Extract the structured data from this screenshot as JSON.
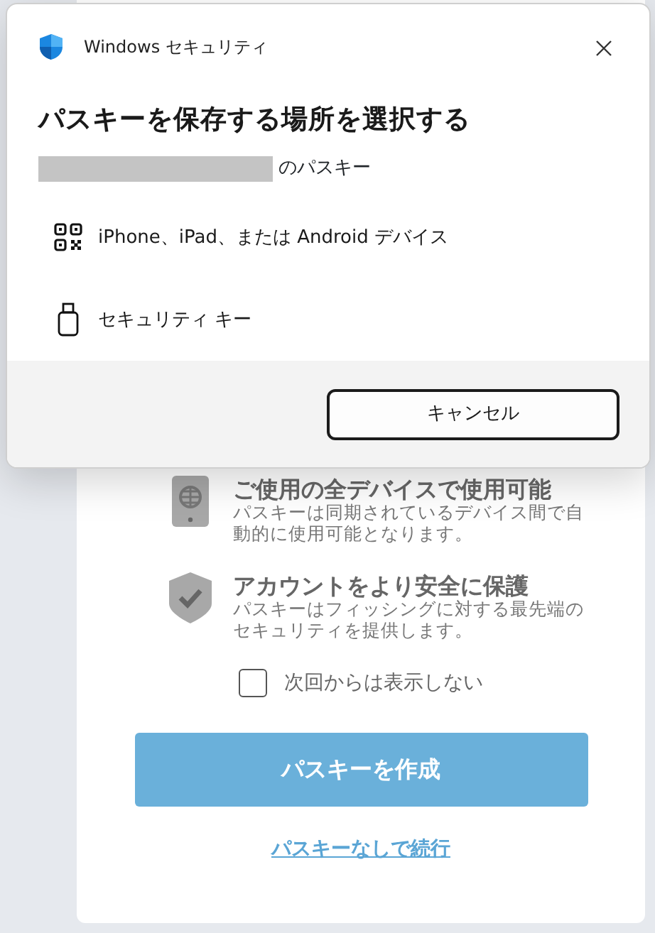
{
  "dialog": {
    "app_title": "Windows セキュリティ",
    "heading": "パスキーを保存する場所を選択する",
    "account_suffix": "のパスキー",
    "options": [
      {
        "kind": "qr",
        "label": "iPhone、iPad、または Android デバイス"
      },
      {
        "kind": "security_key",
        "label": "セキュリティ キー"
      }
    ],
    "cancel_button": "キャンセル"
  },
  "page": {
    "features": [
      {
        "kind": "device",
        "title": "ご使用の全デバイスで使用可能",
        "description": "パスキーは同期されているデバイス間で自動的に使用可能となります。"
      },
      {
        "kind": "shield",
        "title": "アカウントをより安全に保護",
        "description": "パスキーはフィッシングに対する最先端のセキュリティを提供します。"
      }
    ],
    "dont_show_again": {
      "label": "次回からは表示しない",
      "checked": false
    },
    "primary_button": "パスキーを作成",
    "skip_link": "パスキーなしで続行"
  }
}
